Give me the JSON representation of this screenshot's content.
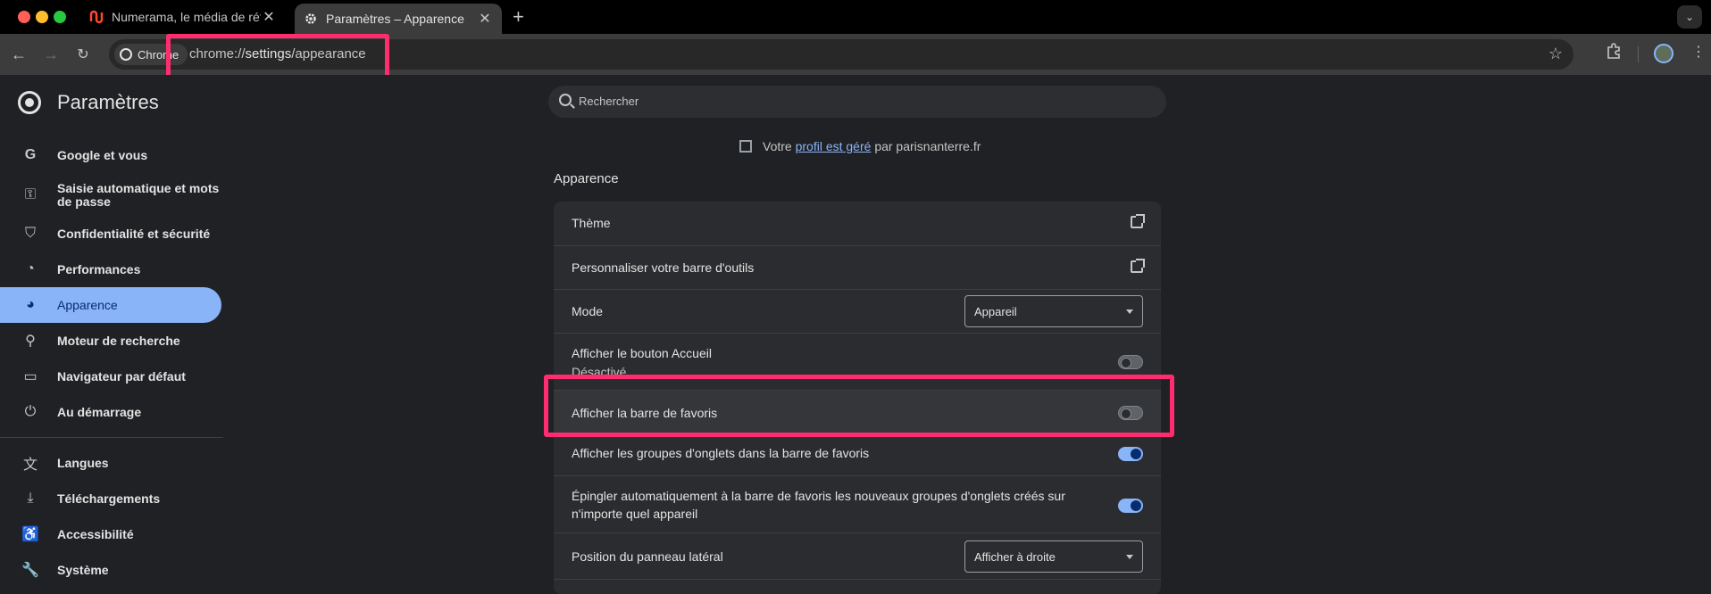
{
  "tabs": [
    {
      "title": "Numerama, le média de référence",
      "favicon": "numerama-icon",
      "active": false
    },
    {
      "title": "Paramètres – Apparence",
      "favicon": "gear-icon",
      "active": true
    }
  ],
  "toolbar": {
    "chip_label": "Chrome",
    "url_scheme": "chrome://",
    "url_host": "settings",
    "url_path": "/appearance"
  },
  "settings": {
    "brand": "Paramètres",
    "search_placeholder": "Rechercher",
    "managed_prefix": "Votre",
    "managed_link": "profil est géré",
    "managed_suffix": "par parisnanterre.fr",
    "nav": [
      {
        "label": "Google et vous",
        "icon": "google-icon"
      },
      {
        "label": "Saisie automatique et mots de passe",
        "icon": "key-icon"
      },
      {
        "label": "Confidentialité et sécurité",
        "icon": "shield-icon"
      },
      {
        "label": "Performances",
        "icon": "gauge-icon"
      },
      {
        "label": "Apparence",
        "icon": "palette-icon",
        "active": true
      },
      {
        "label": "Moteur de recherche",
        "icon": "search-icon"
      },
      {
        "label": "Navigateur par défaut",
        "icon": "browser-window-icon"
      },
      {
        "label": "Au démarrage",
        "icon": "power-icon"
      },
      {
        "label": "Langues",
        "icon": "translate-icon"
      },
      {
        "label": "Téléchargements",
        "icon": "download-icon"
      },
      {
        "label": "Accessibilité",
        "icon": "accessibility-icon"
      },
      {
        "label": "Système",
        "icon": "wrench-icon"
      }
    ],
    "section_title": "Apparence",
    "rows": {
      "theme": "Thème",
      "toolbar": "Personnaliser votre barre d'outils",
      "mode_label": "Mode",
      "mode_value": "Appareil",
      "home_label": "Afficher le bouton Accueil",
      "home_sub": "Désactivé",
      "home_on": false,
      "bookmarks_label": "Afficher la barre de favoris",
      "bookmarks_on": false,
      "tabgroups_label": "Afficher les groupes d'onglets dans la barre de favoris",
      "tabgroups_on": true,
      "pin_label_1": "Épingler automatiquement à la barre de favoris les nouveaux groupes d'onglets créés sur",
      "pin_label_2": "n'importe quel appareil",
      "pin_on": true,
      "sidepanel_label": "Position du panneau latéral",
      "sidepanel_value": "Afficher à droite"
    }
  },
  "colors": {
    "accent": "#8ab4f8",
    "highlight": "#ff2d6f"
  }
}
